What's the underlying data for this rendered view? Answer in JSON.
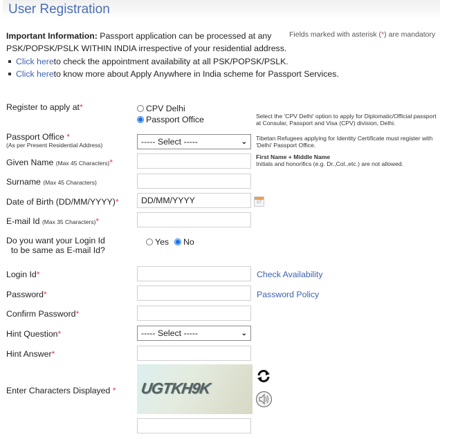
{
  "page": {
    "title": "User Registration",
    "important_label": "Important Information:",
    "important_text_1": " Passport application can be processed at any",
    "important_text_2": "PSK/POPSK/PSLK WITHIN INDIA irrespective of your residential address.",
    "mandatory_prefix": "Fields marked with asterisk (",
    "mandatory_star": "*",
    "mandatory_suffix": ") are mandatory",
    "bullets": [
      {
        "link": "Click here",
        "text": " to check the appointment availability at all PSK/POPSK/PSLK."
      },
      {
        "link": "Click here",
        "text": " to know more about Apply Anywhere in India scheme for Passport Services."
      }
    ]
  },
  "form": {
    "register_at": {
      "label": "Register to apply at",
      "options": [
        "CPV Delhi",
        "Passport Office"
      ],
      "selected": "Passport Office",
      "hint": "Select the 'CPV Delhi' option to apply for Diplomatic/Official passport at Consular, Passport and Visa (CPV) division, Delhi."
    },
    "passport_office": {
      "label": "Passport Office ",
      "sublabel": "(As per Present Residential Address)",
      "value": "----- Select -----",
      "hint": "Tibetan Refugees applying for Identity Certificate must register with 'Delhi' Passport Office."
    },
    "given_name": {
      "label": "Given Name ",
      "sublabel": "(Max 45 Characters)",
      "value": "",
      "hint_title": "First Name + Middle Name",
      "hint": "Initials and honorifics (e.g. Dr.,Col.,etc.) are not allowed."
    },
    "surname": {
      "label": "Surname ",
      "sublabel": "(Max 45 Characters)",
      "value": ""
    },
    "dob": {
      "label": "Date of Birth (DD/MM/YYYY)",
      "value": "DD/MM/YYYY",
      "icon": "calendar-icon"
    },
    "email": {
      "label": "E-mail Id ",
      "sublabel": "(Max 35 Characters)",
      "value": ""
    },
    "login_same": {
      "label_1": "Do you want your Login Id",
      "label_2": "to be same as E-mail Id?",
      "options": [
        "Yes",
        "No"
      ],
      "selected": "No"
    },
    "login_id": {
      "label": "Login Id",
      "value": "",
      "action": "Check Availability"
    },
    "password": {
      "label": "Password",
      "value": "",
      "action": "Password Policy"
    },
    "confirm_password": {
      "label": "Confirm Password",
      "value": ""
    },
    "hint_question": {
      "label": "Hint Question",
      "value": "----- Select -----"
    },
    "hint_answer": {
      "label": "Hint Answer",
      "value": ""
    },
    "captcha": {
      "label": "Enter Characters Displayed ",
      "text": "UGTKH9K",
      "value": "",
      "refresh_icon": "refresh-icon",
      "audio_icon": "speaker-icon"
    },
    "star": "*"
  },
  "colors": {
    "title": "#4a6fb5",
    "link": "#3d62b0",
    "required": "#e04050",
    "radio_selected": "#1a73e8"
  }
}
